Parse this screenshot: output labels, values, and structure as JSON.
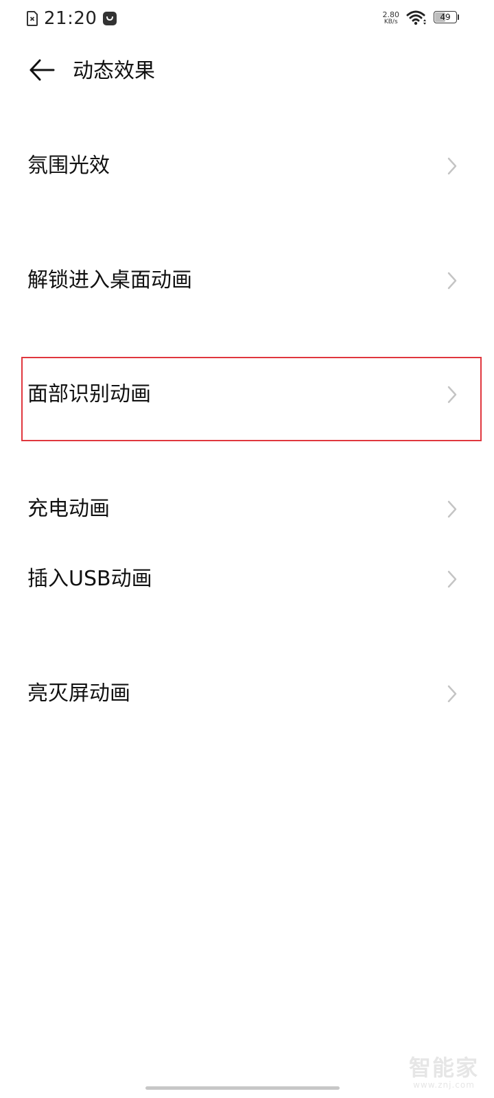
{
  "status_bar": {
    "time": "21:20",
    "network_speed_value": "2.80",
    "network_speed_unit": "KB/s",
    "battery_level": "49",
    "icons": [
      "no-sim-icon",
      "bag-notification-icon",
      "wifi-icon",
      "battery-icon"
    ]
  },
  "header": {
    "title": "动态效果",
    "back_icon": "back-arrow-icon"
  },
  "list": {
    "items": [
      {
        "label": "氛围光效"
      },
      {
        "label": "解锁进入桌面动画"
      },
      {
        "label": "面部识别动画",
        "highlighted": true
      },
      {
        "label": "充电动画"
      },
      {
        "label": "插入USB动画"
      },
      {
        "label": "亮灭屏动画"
      }
    ],
    "chevron_icon": "chevron-right-icon"
  },
  "watermark": {
    "title": "智能家",
    "url": "www.znj.com"
  },
  "colors": {
    "highlight": "#e0363d",
    "chevron": "#c4c4c4",
    "text": "#111111",
    "background": "#ffffff"
  }
}
